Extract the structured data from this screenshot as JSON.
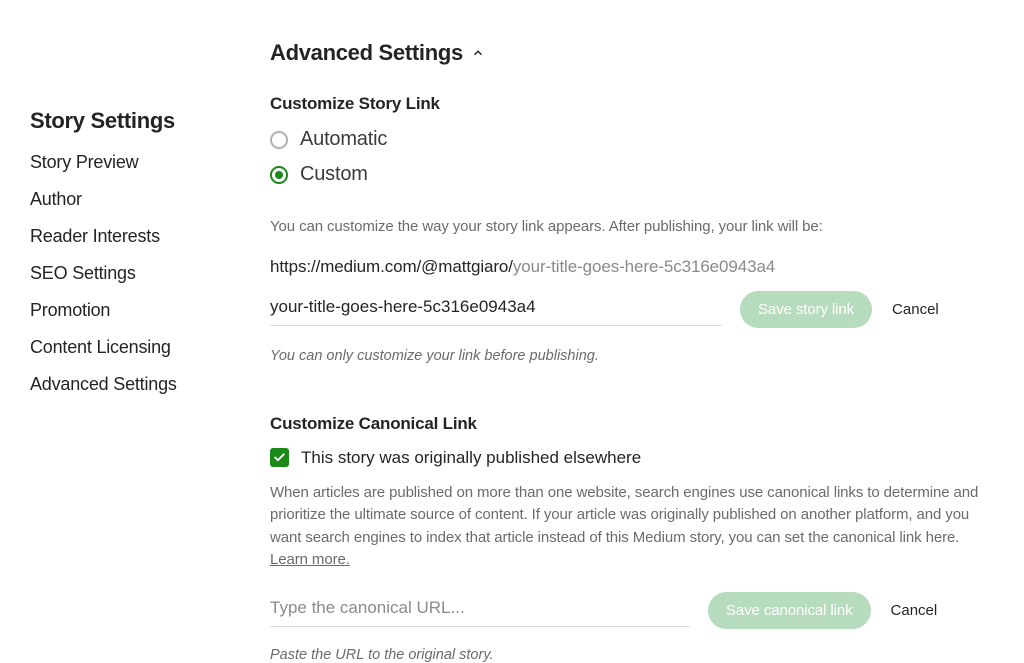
{
  "sidebar": {
    "title": "Story Settings",
    "items": [
      {
        "label": "Story Preview",
        "name": "sidebar-item-story-preview"
      },
      {
        "label": "Author",
        "name": "sidebar-item-author"
      },
      {
        "label": "Reader Interests",
        "name": "sidebar-item-reader-interests"
      },
      {
        "label": "SEO Settings",
        "name": "sidebar-item-seo-settings"
      },
      {
        "label": "Promotion",
        "name": "sidebar-item-promotion"
      },
      {
        "label": "Content Licensing",
        "name": "sidebar-item-content-licensing"
      },
      {
        "label": "Advanced Settings",
        "name": "sidebar-item-advanced-settings"
      }
    ]
  },
  "main": {
    "section_title": "Advanced Settings",
    "story_link": {
      "title": "Customize Story Link",
      "option_auto": "Automatic",
      "option_custom": "Custom",
      "help1": "You can customize the way your story link appears. After publishing, your link will be:",
      "url_base": "https://medium.com/@mattgiaro/",
      "url_slug": "your-title-goes-here-5c316e0943a4",
      "input_value": "your-title-goes-here-5c316e0943a4",
      "save_label": "Save story link",
      "cancel_label": "Cancel",
      "help2": "You can only customize your link before publishing."
    },
    "canonical": {
      "title": "Customize Canonical Link",
      "checkbox_label": "This story was originally published elsewhere",
      "help": "When articles are published on more than one website, search engines use canonical links to determine and prioritize the ultimate source of content. If your article was originally published on another platform, and you want search engines to index that article instead of this Medium story, you can set the canonical link here. ",
      "learn_more": "Learn more.",
      "placeholder": "Type the canonical URL...",
      "save_label": "Save canonical link",
      "cancel_label": "Cancel",
      "help2": "Paste the URL to the original story."
    }
  }
}
